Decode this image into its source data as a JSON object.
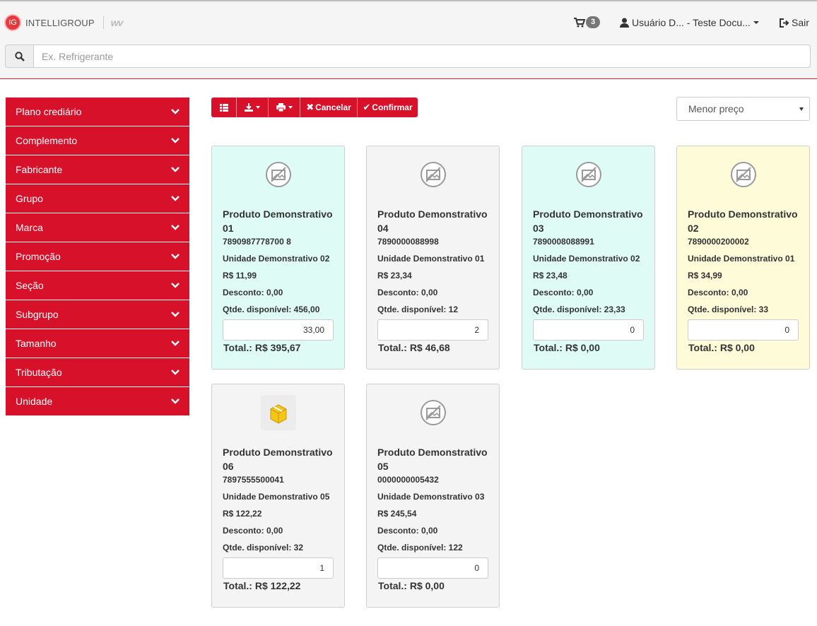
{
  "header": {
    "logo_badge": "IG",
    "logo_text": "INTELLIGROUP",
    "logo_mark": "wv",
    "cart_count": "3",
    "user_label": "Usuário D... - Teste Docu...",
    "logout_label": "Sair"
  },
  "search": {
    "placeholder": "Ex. Refrigerante"
  },
  "sidebar": {
    "items": [
      {
        "label": "Plano crediário"
      },
      {
        "label": "Complemento"
      },
      {
        "label": "Fabricante"
      },
      {
        "label": "Grupo"
      },
      {
        "label": "Marca"
      },
      {
        "label": "Promoção"
      },
      {
        "label": "Seção"
      },
      {
        "label": "Subgrupo"
      },
      {
        "label": "Tamanho"
      },
      {
        "label": "Tributação"
      },
      {
        "label": "Unidade"
      }
    ]
  },
  "toolbar": {
    "cancel_label": "Cancelar",
    "confirm_label": "Confirmar"
  },
  "sort": {
    "selected": "Menor preço"
  },
  "products": [
    {
      "name": "Produto Demonstrativo 01",
      "code": "7890987778700 8",
      "unit": "Unidade Demonstrativo 02",
      "price": "R$ 11,99",
      "discount": "Desconto: 0,00",
      "available": "Qtde. disponível: 456,00",
      "qty": "33,00",
      "total": "Total.: R$ 395,67",
      "bg": "#dffbf6",
      "image": "no-image-icon"
    },
    {
      "name": "Produto Demonstrativo 04",
      "code": "7890000088998",
      "unit": "Unidade Demonstrativo 01",
      "price": "R$ 23,34",
      "discount": "Desconto: 0,00",
      "available": "Qtde. disponível: 12",
      "qty": "2",
      "total": "Total.: R$ 46,68",
      "bg": "#f4f4f4",
      "image": "no-image-icon"
    },
    {
      "name": "Produto Demonstrativo 03",
      "code": "7890008088991",
      "unit": "Unidade Demonstrativo 02",
      "price": "R$ 23,48",
      "discount": "Desconto: 0,00",
      "available": "Qtde. disponível: 23,33",
      "qty": "0",
      "total": "Total.: R$ 0,00",
      "bg": "#dffbf6",
      "image": "no-image-icon"
    },
    {
      "name": "Produto Demonstrativo 02",
      "code": "7890000200002",
      "unit": "Unidade Demonstrativo 01",
      "price": "R$ 34,99",
      "discount": "Desconto: 0,00",
      "available": "Qtde. disponível: 33",
      "qty": "0",
      "total": "Total.: R$ 0,00",
      "bg": "#fefbd9",
      "image": "no-image-icon"
    },
    {
      "name": "Produto Demonstrativo 06",
      "code": "7897555500041",
      "unit": "Unidade Demonstrativo 05",
      "price": "R$ 122,22",
      "discount": "Desconto: 0,00",
      "available": "Qtde. disponível: 32",
      "qty": "1",
      "total": "Total.: R$ 122,22",
      "bg": "#f4f4f4",
      "image": "product-box-icon"
    },
    {
      "name": "Produto Demonstrativo 05",
      "code": "0000000005432",
      "unit": "Unidade Demonstrativo 03",
      "price": "R$ 245,54",
      "discount": "Desconto: 0,00",
      "available": "Qtde. disponível: 122",
      "qty": "0",
      "total": "Total.: R$ 0,00",
      "bg": "#f4f4f4",
      "image": "no-image-icon"
    }
  ]
}
